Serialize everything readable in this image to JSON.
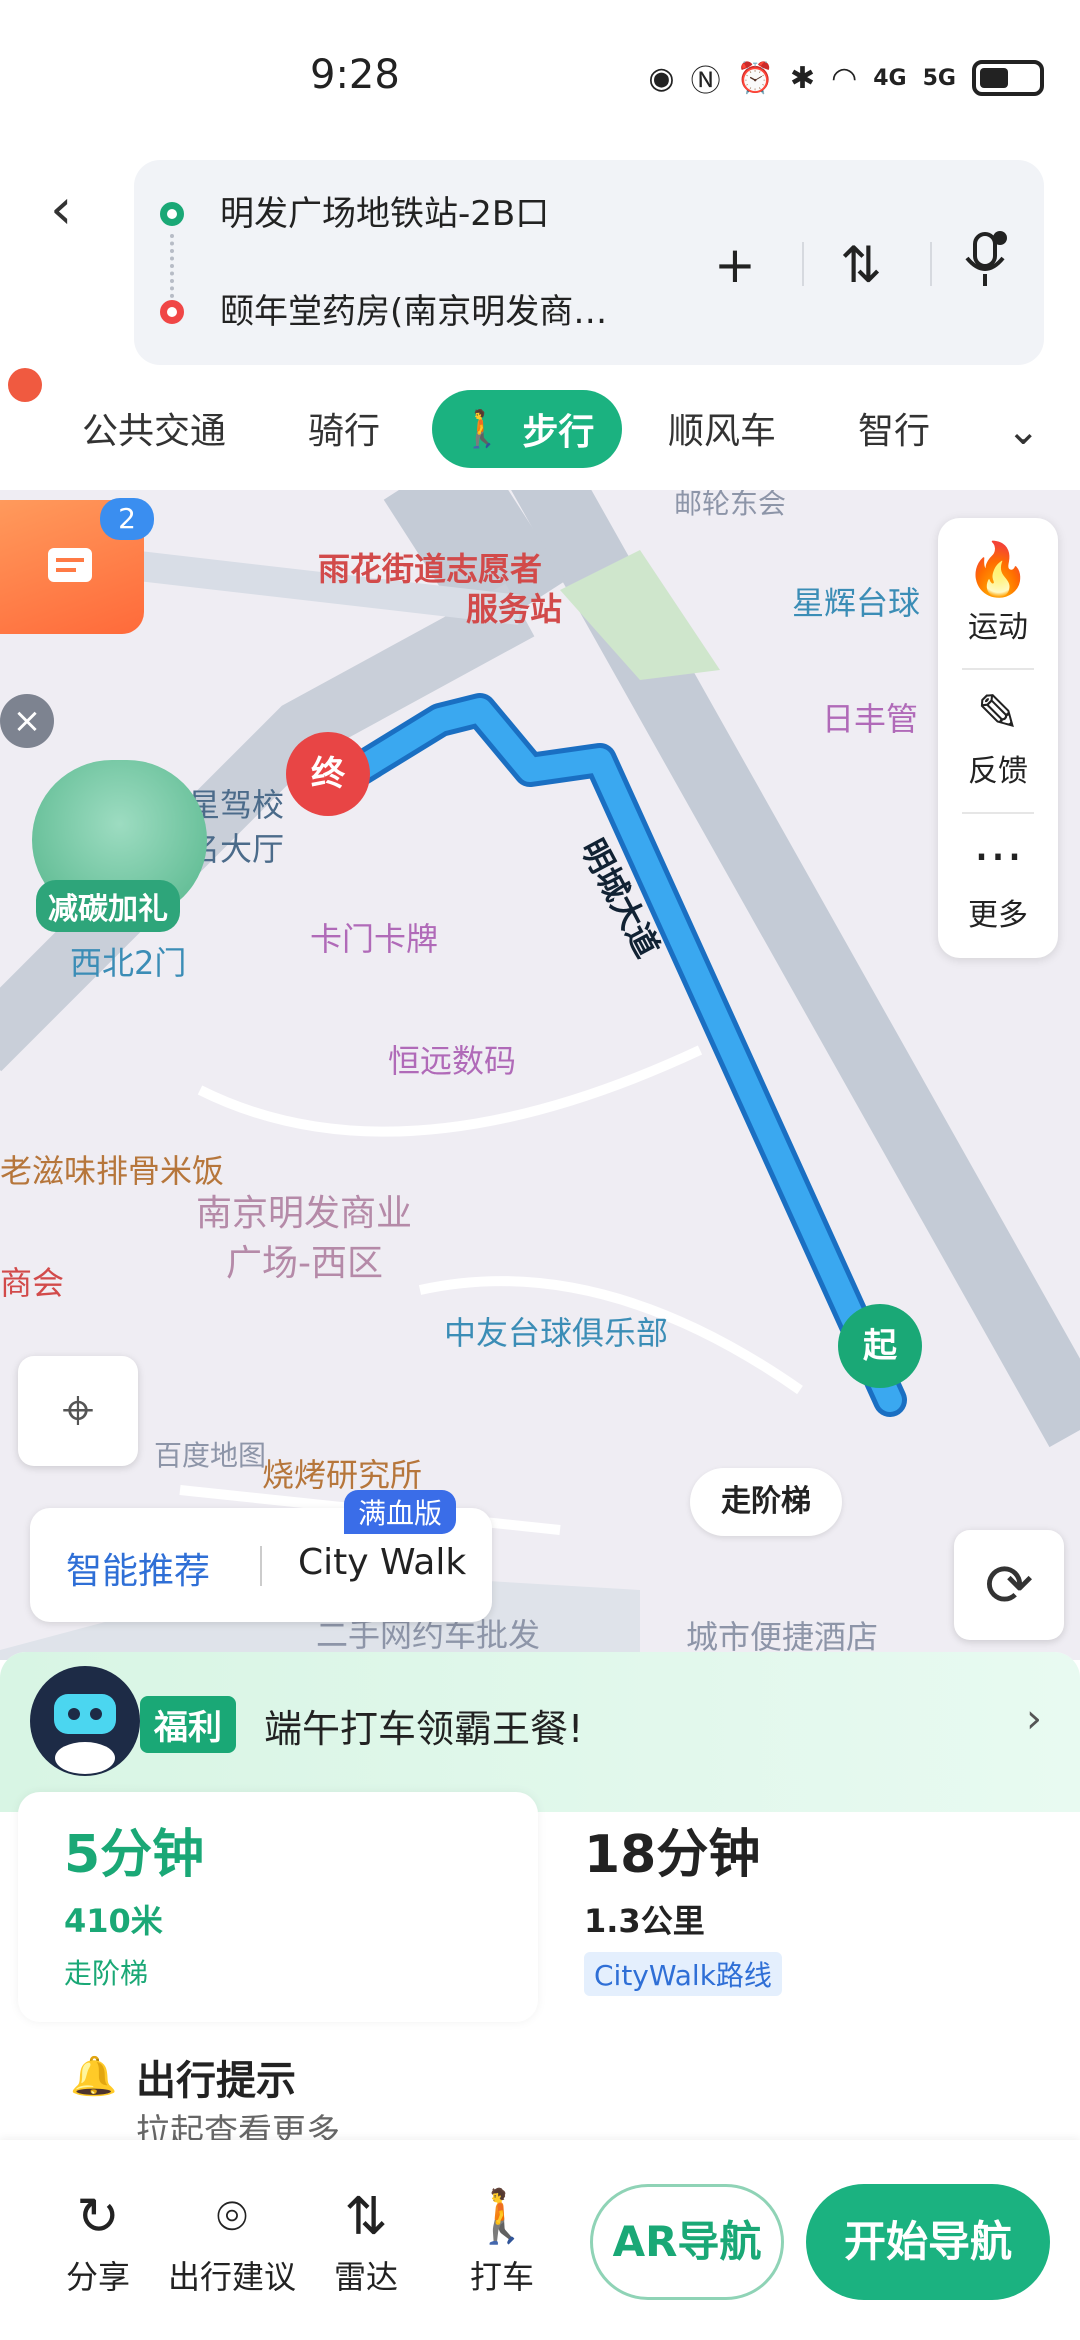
{
  "status_bar": {
    "time": "9:28",
    "network_4g": "4G",
    "network_5g": "5G"
  },
  "header": {
    "start_place": "明发广场地铁站-2B口",
    "end_place": "颐年堂药房(南京明发商…"
  },
  "tabs": {
    "items": [
      "公共交通",
      "骑行",
      "步行",
      "顺风车",
      "智行"
    ],
    "active": "步行"
  },
  "map": {
    "labels": {
      "volunteer": "雨花街道志愿者",
      "volunteer2": "服务站",
      "star": "星辉台球",
      "rifeng": "日丰管",
      "xingjia": "星驾校",
      "hall": "名大厅",
      "northwest_gate": "西北2门",
      "card": "卡门卡牌",
      "road": "明城大道",
      "hengyuan": "恒远数码",
      "ribs": "老滋味排骨米饭",
      "mall": "南京明发商业",
      "mall2": "广场-西区",
      "south_hui": "商会",
      "zhongyou": "中友台球俱乐部",
      "bbq": "烧烤研究所",
      "hotel": "城市便捷酒店",
      "second_hand": "二手网约车批发",
      "baidu_map": "百度地图",
      "post": "邮轮东会"
    },
    "message_badge": "2",
    "promo_label": "减碳加礼",
    "side_panel": {
      "sport": "运动",
      "feedback": "反馈",
      "more": "更多"
    },
    "end_marker": "终",
    "start_marker": "起",
    "stairs_label": "走阶梯",
    "mode_switch": {
      "smart": "智能推荐",
      "citywalk": "City Walk",
      "tag": "满血版"
    }
  },
  "sheet": {
    "promo": {
      "tag": "福利",
      "text": "端午打车领霸王餐!"
    },
    "plans": [
      {
        "duration": "5分钟",
        "distance": "410米",
        "note": "走阶梯"
      },
      {
        "duration": "18分钟",
        "distance": "1.3公里",
        "note": "CityWalk路线"
      }
    ],
    "tip": {
      "title": "出行提示",
      "desc": "拉起查看更多"
    }
  },
  "actions": {
    "share": "分享",
    "advice": "出行建议",
    "radar": "雷达",
    "taxi": "打车",
    "ar": "AR导航",
    "start": "开始导航"
  },
  "colors": {
    "accent": "#1bb280",
    "route": "#2e9ee8",
    "end": "#e84545"
  },
  "icons": [
    "eye-icon",
    "nfc-icon",
    "alarm-icon",
    "bluetooth-icon",
    "wifi-icon",
    "battery-icon",
    "back-icon",
    "plus-icon",
    "swap-icon",
    "mic-icon",
    "walk-icon",
    "chevron-down-icon",
    "flame-icon",
    "pen-icon",
    "more-icon",
    "locate-icon",
    "refresh-icon",
    "bell-icon",
    "share-icon",
    "pin-icon",
    "radar-icon",
    "taxi-icon"
  ]
}
